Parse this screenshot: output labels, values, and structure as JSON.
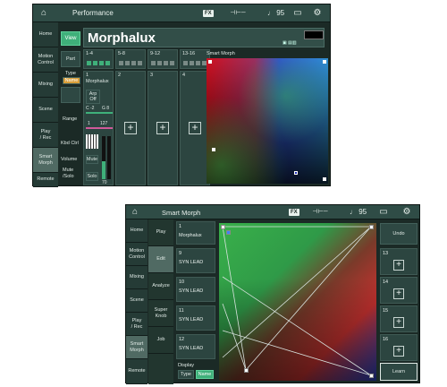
{
  "panel1": {
    "header": {
      "title": "Performance",
      "fx": "FX",
      "tempo": "95"
    },
    "nav": [
      "Home",
      "Motion\nControl",
      "Mixing",
      "Scene",
      "Play\n/ Rec",
      "Smart\nMorph",
      "Remote"
    ],
    "nav_selected": 5,
    "view_btn": "View",
    "perf_name": "Morphalux",
    "part_label": "Part",
    "type_label": "Type",
    "name_btn": "Name",
    "groups": [
      "1-4",
      "5-8",
      "9-12",
      "13-16"
    ],
    "parts": [
      {
        "num": "1",
        "name": "Morphalux"
      },
      {
        "num": "2",
        "name": ""
      },
      {
        "num": "3",
        "name": ""
      },
      {
        "num": "4",
        "name": ""
      }
    ],
    "arp": "Arp\nOff",
    "range_label": "Range",
    "note_low": "C -2",
    "note_high": "G 8",
    "vel_low": "1",
    "vel_high": "127",
    "kbd_label": "Kbd Ctrl",
    "volume_label": "Volume",
    "mute_solo_label": "Mute\n/Solo",
    "mute_btn": "Mute",
    "solo_btn": "Solo",
    "volume_value": "70",
    "smart_morph_title": "Smart Morph"
  },
  "panel2": {
    "header": {
      "title": "Smart Morph",
      "fx": "FX",
      "tempo": "95"
    },
    "nav1": [
      "Home",
      "Motion\nControl",
      "Mixing",
      "Scene",
      "Play\n/ Rec",
      "Smart\nMorph",
      "Remote"
    ],
    "nav1_selected": 5,
    "nav2": [
      "Play",
      "Edit",
      "Analyze",
      "Super\nKnob",
      "Job"
    ],
    "nav2_selected": 1,
    "parts": [
      {
        "num": "1",
        "name": "Morphalux"
      },
      {
        "num": "9",
        "name": "SYN LEAD"
      },
      {
        "num": "10",
        "name": "SYN LEAD"
      },
      {
        "num": "11",
        "name": "SYN LEAD"
      },
      {
        "num": "12",
        "name": "SYN LEAD"
      }
    ],
    "display_label": "Display",
    "type_btn": "Type",
    "name_btn": "Name",
    "undo_btn": "Undo",
    "right_slots": [
      "13",
      "14",
      "15",
      "16"
    ],
    "learn_btn": "Learn"
  },
  "colors": {
    "accent_green": "#3fb07a",
    "accent_orange": "#d89e3a",
    "panel_bg": "#1b2a26"
  }
}
